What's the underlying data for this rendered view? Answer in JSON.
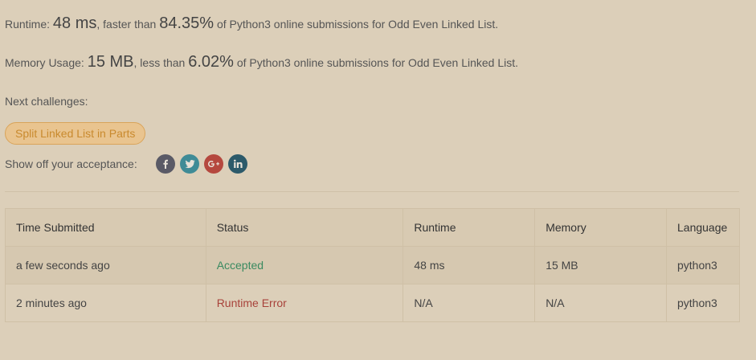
{
  "runtime": {
    "prefix": "Runtime: ",
    "value": "48 ms",
    "middle": ", faster than ",
    "percent": "84.35%",
    "suffix": " of Python3 online submissions for Odd Even Linked List."
  },
  "memory": {
    "prefix": "Memory Usage: ",
    "value": "15 MB",
    "middle": ", less than ",
    "percent": "6.02%",
    "suffix": " of Python3 online submissions for Odd Even Linked List."
  },
  "next": {
    "label": "Next challenges:",
    "challenges": [
      "Split Linked List in Parts"
    ]
  },
  "share": {
    "label": "Show off your acceptance:",
    "icons": [
      "facebook-icon",
      "twitter-icon",
      "google-plus-icon",
      "linkedin-icon"
    ]
  },
  "table": {
    "headers": [
      "Time Submitted",
      "Status",
      "Runtime",
      "Memory",
      "Language"
    ],
    "rows": [
      {
        "time": "a few seconds ago",
        "status": "Accepted",
        "runtime": "48 ms",
        "memory": "15 MB",
        "language": "python3"
      },
      {
        "time": "2 minutes ago",
        "status": "Runtime Error",
        "runtime": "N/A",
        "memory": "N/A",
        "language": "python3"
      }
    ]
  },
  "colors": {
    "background": "#dccfb9",
    "accepted": "#3a8a60",
    "error": "#a8423a",
    "tag_border": "#d9a45a",
    "tag_text": "#c98a2e"
  }
}
